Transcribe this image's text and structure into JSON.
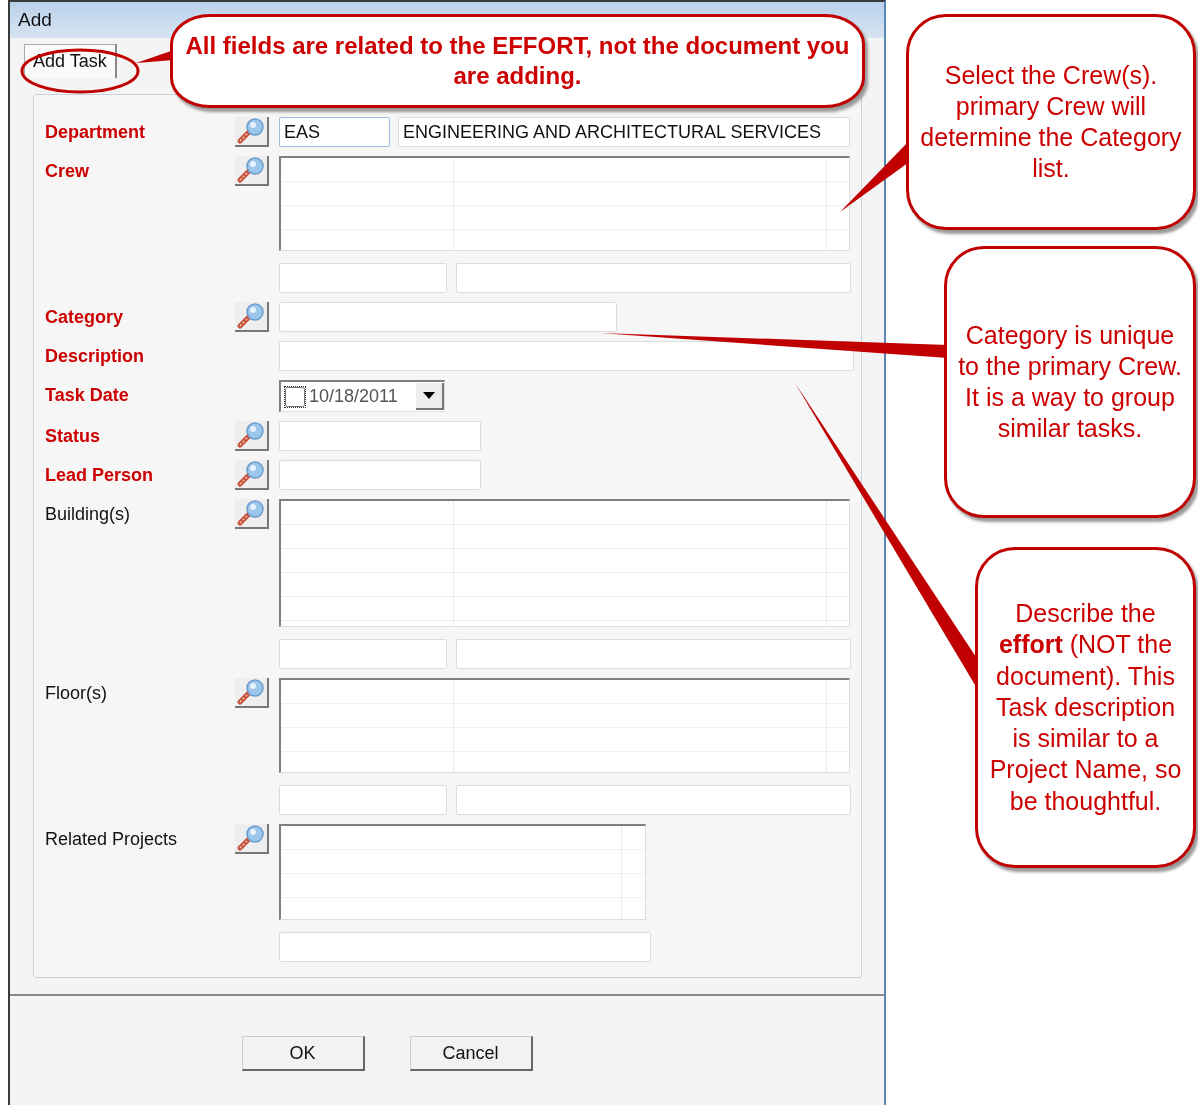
{
  "window": {
    "title": "Add"
  },
  "tabs": [
    {
      "label": "Add Task",
      "selected": true
    }
  ],
  "fields": [
    {
      "label": "Department",
      "required": true,
      "lookup": true,
      "kind": "code-name",
      "code": "EAS",
      "name": "ENGINEERING AND ARCHITECTURAL SERVICES"
    },
    {
      "label": "Crew",
      "required": true,
      "lookup": true,
      "kind": "list"
    },
    {
      "label": "Category",
      "required": true,
      "lookup": true,
      "kind": "medium"
    },
    {
      "label": "Description",
      "required": true,
      "lookup": false,
      "kind": "long"
    },
    {
      "label": "Task Date",
      "required": true,
      "lookup": false,
      "kind": "date",
      "value": "10/18/2011",
      "checked": false
    },
    {
      "label": "Status",
      "required": true,
      "lookup": true,
      "kind": "short"
    },
    {
      "label": "Lead Person",
      "required": true,
      "lookup": true,
      "kind": "short"
    },
    {
      "label": "Building(s)",
      "required": false,
      "lookup": true,
      "kind": "list-tall"
    },
    {
      "label": "Floor(s)",
      "required": false,
      "lookup": true,
      "kind": "list"
    },
    {
      "label": "Related Projects",
      "required": false,
      "lookup": true,
      "kind": "list-narrow"
    }
  ],
  "buttons": [
    "OK",
    "Cancel"
  ],
  "callouts": [
    {
      "kind": "banner",
      "text": "All fields are related to the EFFORT, not the document you are adding."
    },
    {
      "kind": "note",
      "text": "Select the Crew(s). primary Crew will determine the Category list."
    },
    {
      "kind": "note",
      "text": "Category is unique to the primary Crew.  It is a way to group similar tasks."
    },
    {
      "kind": "note",
      "text": "Describe the **effort** (NOT the document). This Task description is similar to a Project Name, so be thoughtful."
    }
  ]
}
